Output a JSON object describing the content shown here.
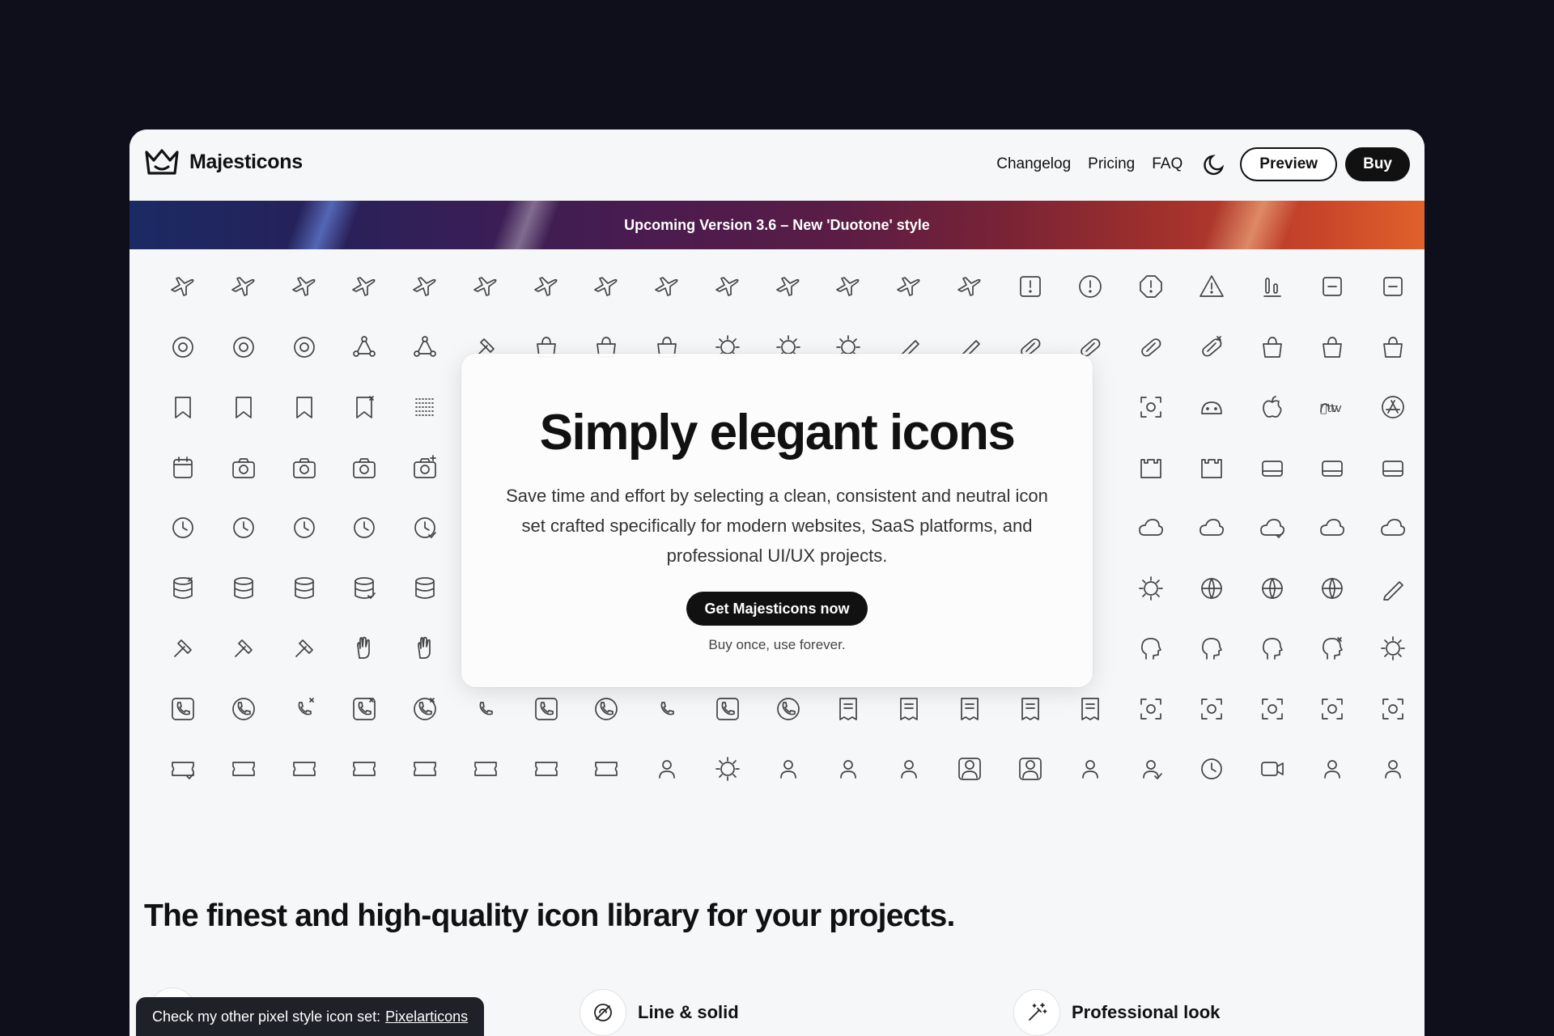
{
  "brand": {
    "name": "Majesticons"
  },
  "nav": {
    "links": [
      "Changelog",
      "Pricing",
      "FAQ"
    ],
    "preview_label": "Preview",
    "buy_label": "Buy",
    "theme_icon": "moon-icon"
  },
  "banner": {
    "text": "Upcoming Version 3.6 – New 'Duotone' style"
  },
  "hero": {
    "title": "Simply elegant icons",
    "subtitle": "Save time and effort by selecting a clean, consistent and neutral icon set crafted specifically for modern websites, SaaS platforms, and professional UI/UX projects.",
    "cta_label": "Get Majesticons now",
    "note": "Buy once, use forever."
  },
  "tagline": "The finest and high-quality icon library for your projects.",
  "features": [
    {
      "label": "Line & solid",
      "icon": "line-solid-icon"
    },
    {
      "label": "Professional look",
      "icon": "magic-wand-icon"
    }
  ],
  "toast": {
    "text": "Check my other pixel style icon set:",
    "link": "Pixelarticons"
  },
  "icon_rows": [
    [
      "airplane-icon",
      "airplane-clock-icon",
      "airplane-document-icon",
      "airplane-circle-icon",
      "airplane-timer-icon",
      "airplane-cloud-icon",
      "airplane-settings-icon",
      "airplane-takeoff-icon",
      "airplane-globe-icon",
      "airplane-rocket-icon",
      "airplane-fast-icon",
      "airplane-landing-icon",
      "airplane-refresh-icon",
      "airplane-location-icon",
      "alert-square-icon",
      "alert-circle-icon",
      "alert-octagon-icon",
      "alert-triangle-icon",
      "bar-chart-icon",
      "inbox-icon",
      "note-icon"
    ],
    [
      "atom-circle-icon",
      "aperture-icon",
      "atom-icon",
      "triangle-nodes-icon",
      "nodes-icon",
      "hammer-icon",
      "stroller-icon",
      "backpack-icon",
      "bag-icon",
      "bacteria-icon",
      "virus-icon",
      "medical-gear-icon",
      "ruler-icon",
      "pencil-icon",
      "pill-icon",
      "capsule-icon",
      "bandage-icon",
      "bandage-x-icon",
      "barn-icon",
      "basket-icon",
      "basket-closed-icon"
    ],
    [
      "bookmark-icon",
      "bookmark-edit-icon",
      "bookmark-heart-icon",
      "bookmark-x-icon",
      "grid-dots-icon",
      "hidden",
      "hidden",
      "hidden",
      "hidden",
      "hidden",
      "hidden",
      "hidden",
      "hidden",
      "hidden",
      "hidden",
      "hidden",
      "scan-lock-icon",
      "android-icon",
      "apple-icon",
      "apple-tv-icon",
      "app-store-icon"
    ],
    [
      "calendar-icon",
      "camera-icon",
      "camera-alt-icon",
      "camera-flash-icon",
      "camera-plus-icon",
      "hidden",
      "hidden",
      "hidden",
      "hidden",
      "hidden",
      "hidden",
      "hidden",
      "hidden",
      "hidden",
      "hidden",
      "hidden",
      "castle-icon",
      "castle-alt-icon",
      "drive-icon",
      "drive-off-icon",
      "drive-alt-icon"
    ],
    [
      "clock-hand-icon",
      "clock-flag-icon",
      "clock-arrows-icon",
      "clock-speech-icon",
      "clock-check-icon",
      "hidden",
      "hidden",
      "hidden",
      "hidden",
      "hidden",
      "hidden",
      "hidden",
      "hidden",
      "hidden",
      "hidden",
      "hidden",
      "cloud-sync-icon",
      "cloud-chat-icon",
      "cloud-check-icon",
      "cloud-user-icon",
      "cloud-code-icon"
    ],
    [
      "database-x-icon",
      "database-sync-icon",
      "database-chat-icon",
      "database-check-icon",
      "database-circle-icon",
      "hidden",
      "hidden",
      "hidden",
      "hidden",
      "hidden",
      "hidden",
      "hidden",
      "hidden",
      "hidden",
      "hidden",
      "hidden",
      "brightness-icon",
      "globe-lines-icon",
      "globe-user-icon",
      "globe-off-icon",
      "feather-icon"
    ],
    [
      "hammer-alt-icon",
      "hammer-tool-icon",
      "hammer-square-icon",
      "hand-icon",
      "hand-wave-icon",
      "hidden",
      "hidden",
      "hidden",
      "hidden",
      "hidden",
      "hidden",
      "hidden",
      "hidden",
      "hidden",
      "hidden",
      "hidden",
      "head-icon",
      "head-profile-icon",
      "head-circle-icon",
      "head-x-icon",
      "head-gear-icon"
    ],
    [
      "phone-square-icon",
      "phone-circle-icon",
      "phone-x-icon",
      "phone-square-x-icon",
      "phone-circle-x-icon",
      "phone-dialpad-icon",
      "phone-square-dialpad-icon",
      "phone-circle-dialpad-icon",
      "phone-forward-icon",
      "phone-square-forward-icon",
      "phone-circle-forward-icon",
      "receipt-icon",
      "receipt-percent-icon",
      "receipt-return-icon",
      "receipt-list-icon",
      "receipt-user-icon",
      "scan-icon",
      "scan-box-icon",
      "scan-circle-icon",
      "scan-eye-icon",
      "scan-face-icon"
    ],
    [
      "ticket-check-icon",
      "ticket-icon",
      "ticket-sparkle-icon",
      "ticket-star-icon",
      "ticket-minus-icon",
      "ticket-user-icon",
      "ticket-id-icon",
      "ticket-frame-icon",
      "user-icon",
      "user-settings-icon",
      "user-chat-icon",
      "user-off-icon",
      "user-flag-icon",
      "user-square-icon",
      "user-square-flag-icon",
      "user-group-icon",
      "user-check-icon",
      "user-clock-icon",
      "video-icon",
      "video-user-icon",
      "video-users-icon"
    ]
  ]
}
